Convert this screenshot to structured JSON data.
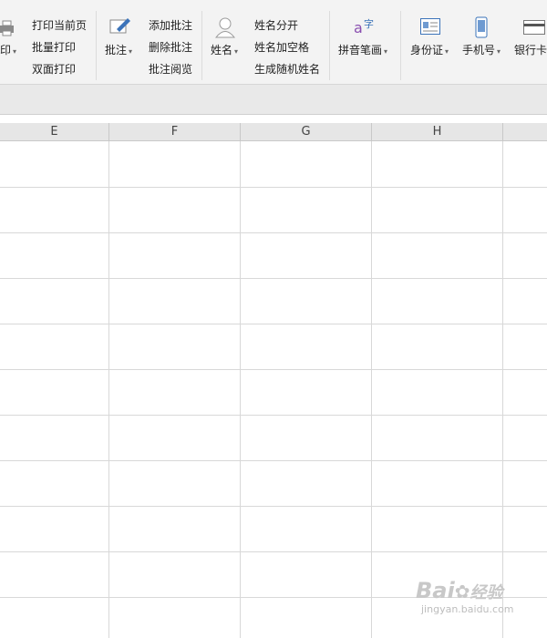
{
  "ribbon": {
    "print_group": {
      "print_label_partial": "印",
      "items": [
        "打印当前页",
        "批量打印",
        "双面打印"
      ]
    },
    "comment_group": {
      "label": "批注",
      "items": [
        "添加批注",
        "删除批注",
        "批注阅览"
      ]
    },
    "name_group": {
      "label": "姓名",
      "items": [
        "姓名分开",
        "姓名加空格",
        "生成随机姓名"
      ]
    },
    "pinyin": {
      "label": "拼音笔画"
    },
    "idcard": {
      "label": "身份证"
    },
    "phone": {
      "label": "手机号"
    },
    "bankcard": {
      "label": "银行卡"
    }
  },
  "columns": [
    "E",
    "F",
    "G",
    "H"
  ],
  "watermark": {
    "brand": "Bai",
    "brand2": "经验",
    "url": "jingyan.baidu.com"
  }
}
